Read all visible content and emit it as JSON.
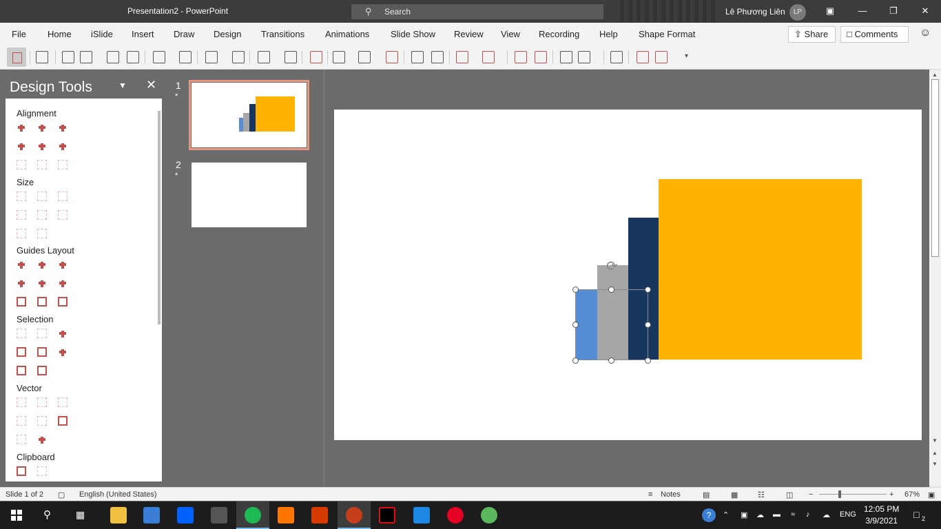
{
  "window": {
    "title": "Presentation2  -  PowerPoint",
    "search_placeholder": "Search",
    "user_name": "Lê Phương Liên",
    "user_initials": "LP"
  },
  "ribbon": {
    "tabs": [
      "File",
      "Home",
      "iSlide",
      "Insert",
      "Draw",
      "Design",
      "Transitions",
      "Animations",
      "Slide Show",
      "Review",
      "View",
      "Recording",
      "Help",
      "Shape Format"
    ],
    "share_label": "Share",
    "comments_label": "Comments"
  },
  "design_tools": {
    "title": "Design Tools",
    "sections": [
      "Alignment",
      "Size",
      "Guides Layout",
      "Selection",
      "Vector",
      "Clipboard"
    ]
  },
  "slides": [
    {
      "number": "1",
      "star": "*"
    },
    {
      "number": "2",
      "star": "*"
    }
  ],
  "slide_shapes": {
    "colors": {
      "light_blue": "#558ed5",
      "gray": "#a6a6a6",
      "navy": "#17375e",
      "gold": "#ffb300"
    }
  },
  "status": {
    "slide_indicator": "Slide 1 of 2",
    "language": "English (United States)",
    "notes_label": "Notes",
    "zoom_minus": "−",
    "zoom_plus": "+",
    "zoom_level": "67%"
  },
  "taskbar": {
    "tray_lang": "ENG",
    "time": "12:05 PM",
    "date": "3/9/2021",
    "notification_count": "2"
  }
}
